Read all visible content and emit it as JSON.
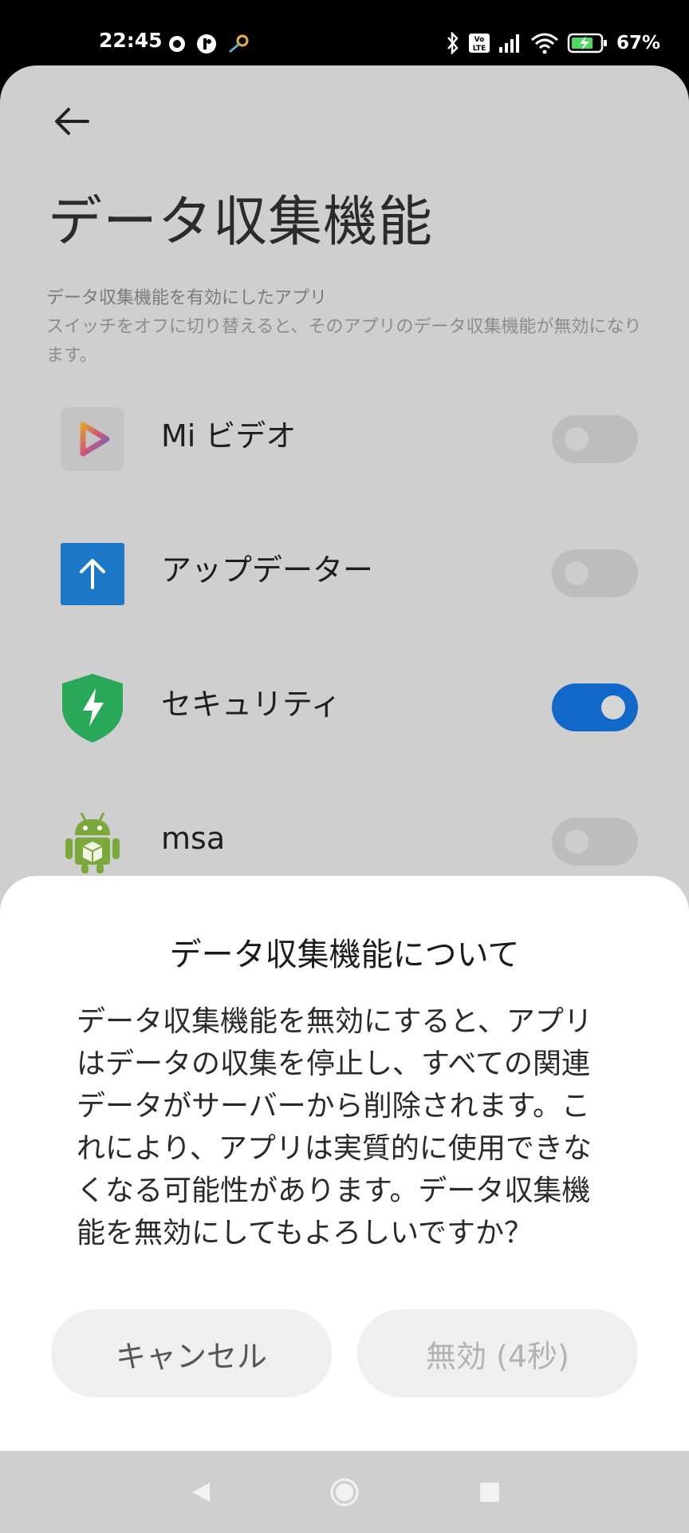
{
  "status_bar": {
    "time": "22:45",
    "battery_percent": "67%",
    "icons": [
      "notification-icon",
      "notification-icon",
      "key-icon",
      "bluetooth-icon",
      "volte-icon",
      "signal-icon",
      "wifi-icon",
      "battery-charging-icon"
    ]
  },
  "page": {
    "title": "データ収集機能",
    "section_subhead": "データ収集機能を有効にしたアプリ",
    "section_desc": "スイッチをオフに切り替えると、そのアプリのデータ収集機能が無効になります。",
    "apps": [
      {
        "name": "Mi ビデオ",
        "enabled": false,
        "icon": "mi-video-icon"
      },
      {
        "name": "アップデーター",
        "enabled": false,
        "icon": "updater-icon"
      },
      {
        "name": "セキュリティ",
        "enabled": true,
        "icon": "security-shield-icon"
      },
      {
        "name": "msa",
        "enabled": false,
        "icon": "android-icon"
      }
    ]
  },
  "dialog": {
    "title": "データ収集機能について",
    "message": "データ収集機能を無効にすると、アプリはデータの収集を停止し、すべての関連データがサーバーから削除されます。これにより、アプリは実質的に使用できなくなる可能性があります。データ収集機能を無効にしてもよろしいですか？",
    "cancel_label": "キャンセル",
    "disable_label": "無効 (4秒)"
  },
  "colors": {
    "toggle_on": "#1268c8",
    "page_dim": "#cfcfcf"
  }
}
